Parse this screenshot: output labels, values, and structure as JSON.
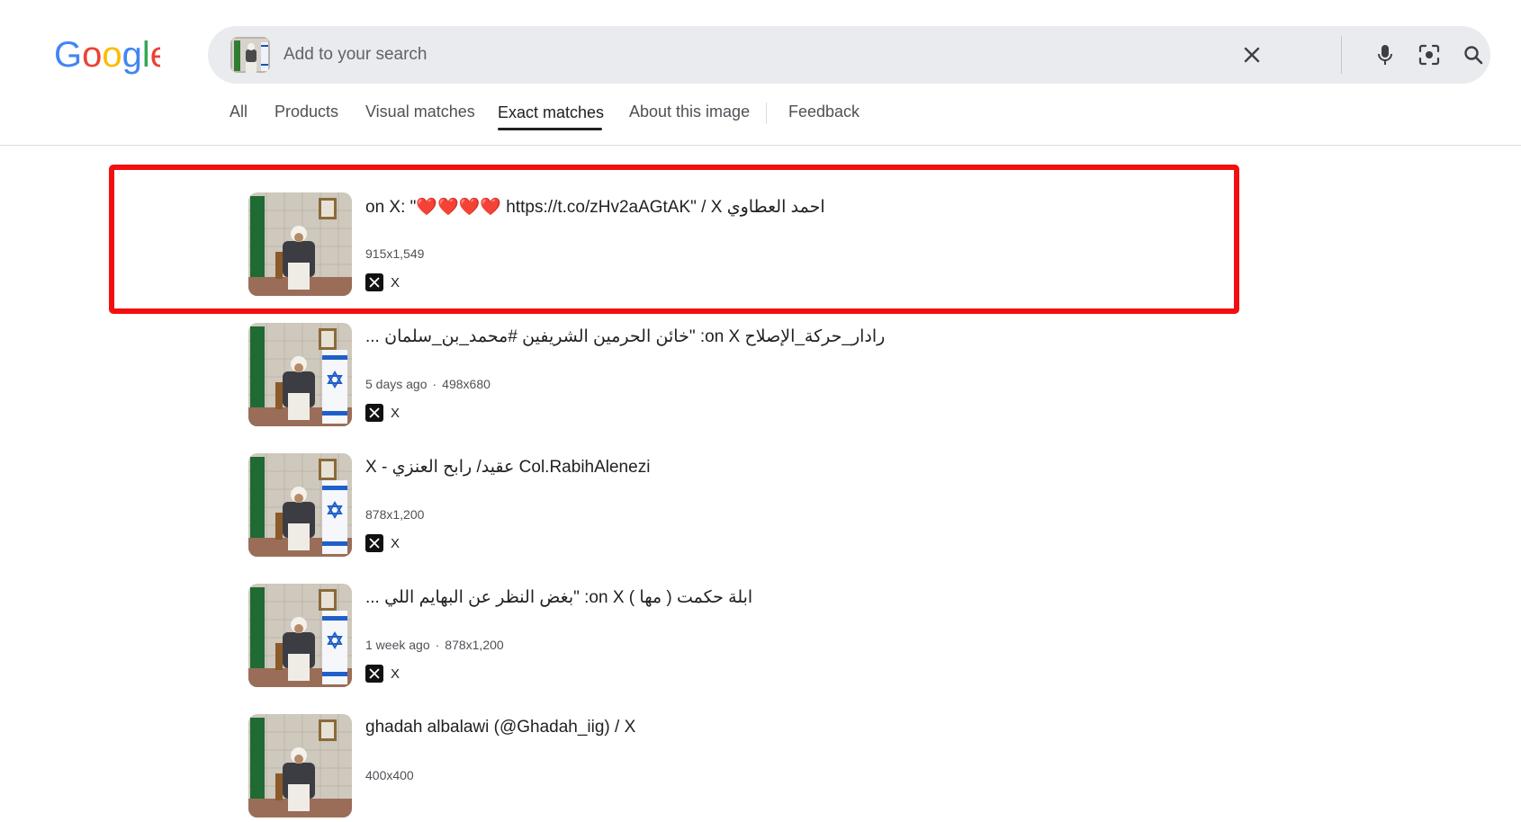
{
  "header": {
    "logo_text": "Google",
    "search": {
      "placeholder": "Add to your search",
      "value": ""
    }
  },
  "tabs": [
    {
      "label": "All",
      "active": false
    },
    {
      "label": "Products",
      "active": false
    },
    {
      "label": "Visual matches",
      "active": false
    },
    {
      "label": "Exact matches",
      "active": true
    },
    {
      "label": "About this image",
      "active": false
    },
    {
      "label": "Feedback",
      "active": false
    }
  ],
  "results": [
    {
      "title": "احمد العطاوي on X: \"❤️❤️❤️❤️ https://t.co/zHv2aAGtAK\" / X",
      "meta": "915x1,549",
      "source": "X",
      "highlighted": true,
      "israeli_flag": false
    },
    {
      "title": "رادار_حركة_الإصلاح on X: \"خائن الحرمين الشريفين #محمد_بن_سلمان ...",
      "age": "5 days ago",
      "meta": "498x680",
      "source": "X",
      "highlighted": false,
      "israeli_flag": true
    },
    {
      "title": "X - عقيد/ رابح العنزي Col.RabihAlenezi",
      "meta": "878x1,200",
      "source": "X",
      "highlighted": false,
      "israeli_flag": true
    },
    {
      "title": "ابلة حكمت ( مها ) on X: \"بغض النظر عن البهايم اللي ...",
      "age": "1 week ago",
      "meta": "878x1,200",
      "source": "X",
      "highlighted": false,
      "israeli_flag": true
    },
    {
      "title": "ghadah albalawi (@Ghadah_iig) / X",
      "meta": "400x400",
      "source": "X",
      "highlighted": false,
      "israeli_flag": false
    }
  ],
  "colors": {
    "highlight_box": "#f30f10",
    "search_bg": "#e9ebee",
    "google_blue": "#4285F4",
    "google_red": "#EA4335",
    "google_yellow": "#FBBC05",
    "google_green": "#34A853"
  },
  "icons": {
    "clear": "close-icon",
    "voice": "microphone-icon",
    "lens": "camera-lens-icon",
    "search": "search-icon",
    "source": "x-logo-icon"
  }
}
